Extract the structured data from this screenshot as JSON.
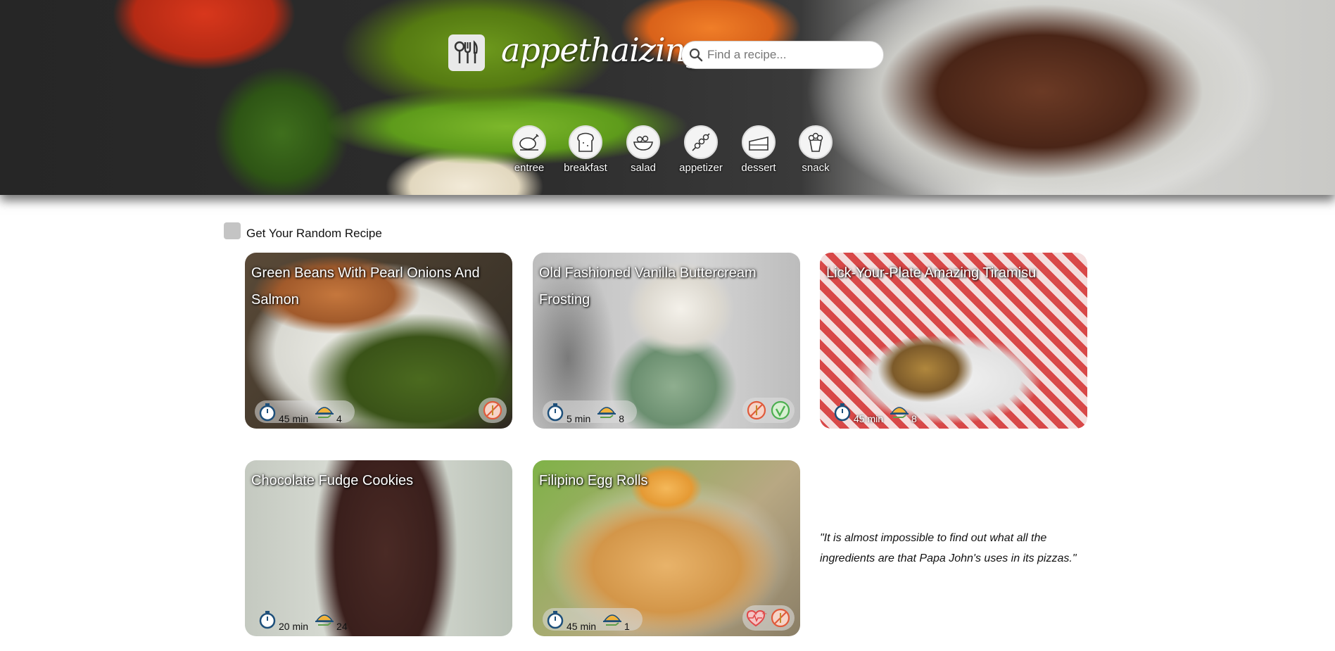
{
  "header": {
    "brand": "appethaizing",
    "search_placeholder": "Find a recipe..."
  },
  "categories": [
    {
      "label": "entree",
      "icon": "chicken-icon"
    },
    {
      "label": "breakfast",
      "icon": "bread-icon"
    },
    {
      "label": "salad",
      "icon": "salad-bowl-icon"
    },
    {
      "label": "appetizer",
      "icon": "skewer-icon"
    },
    {
      "label": "dessert",
      "icon": "cake-icon"
    },
    {
      "label": "snack",
      "icon": "popcorn-icon"
    }
  ],
  "random": {
    "label": "Get Your Random Recipe"
  },
  "recipes": [
    {
      "title": "Green Beans With Pearl Onions And Salmon",
      "time": "45 min",
      "servings": "4",
      "badges": [
        "gluten-free-icon"
      ]
    },
    {
      "title": "Old Fashioned Vanilla Buttercream Frosting",
      "time": "5 min",
      "servings": "8",
      "badges": [
        "gluten-free-icon",
        "vegetarian-icon"
      ]
    },
    {
      "title": "Lick-Your-Plate Amazing Tiramisu",
      "time": "45 min",
      "servings": "8",
      "badges": []
    },
    {
      "title": "Chocolate Fudge Cookies",
      "time": "20 min",
      "servings": "24",
      "badges": []
    },
    {
      "title": "Filipino Egg Rolls",
      "time": "45 min",
      "servings": "1",
      "badges": [
        "healthy-heart-icon",
        "gluten-free-icon"
      ]
    }
  ],
  "quote": "\"It is almost impossible to find out what all the ingredients are that Papa John's uses in its pizzas.\"",
  "colors": {
    "badge_gluten": "#e05a3a",
    "badge_veg": "#4caf50",
    "badge_heart": "#e04848"
  }
}
